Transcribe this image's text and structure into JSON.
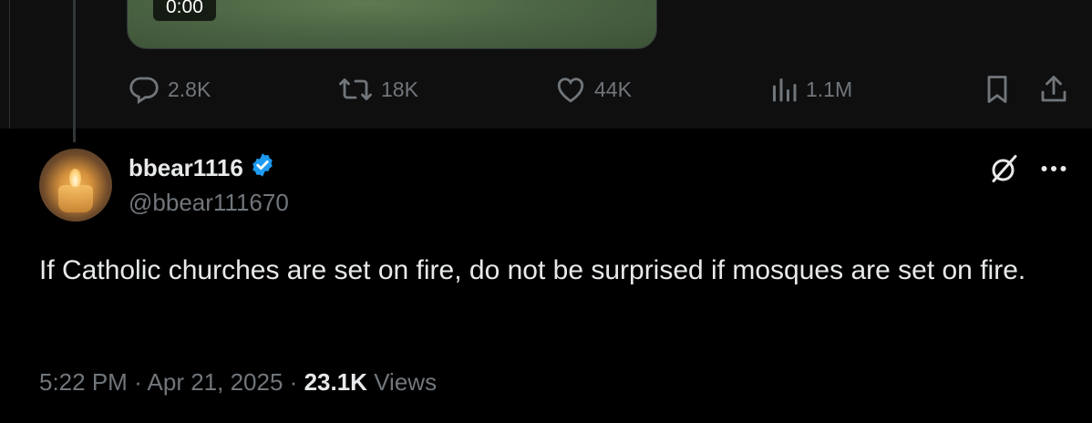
{
  "parent_tweet": {
    "video_time": "0:00",
    "actions": {
      "replies": "2.8K",
      "reposts": "18K",
      "likes": "44K",
      "views": "1.1M"
    }
  },
  "reply_tweet": {
    "display_name": "bbear1116",
    "verified": true,
    "handle": "@bbear111670",
    "text": "If Catholic churches are set on fire, do not be surprised if mosques are set on fire.",
    "time": "5:22 PM",
    "separator": "·",
    "date": "Apr 21, 2025",
    "views_count": "23.1K",
    "views_label": "Views"
  },
  "colors": {
    "background": "#000000",
    "text_primary": "#e7e9ea",
    "text_secondary": "#71767b",
    "verified_blue": "#1d9bf0"
  },
  "icons": [
    "reply-icon",
    "repost-icon",
    "like-icon",
    "views-icon",
    "bookmark-icon",
    "share-icon",
    "verified-badge-icon",
    "grok-icon",
    "more-icon"
  ]
}
